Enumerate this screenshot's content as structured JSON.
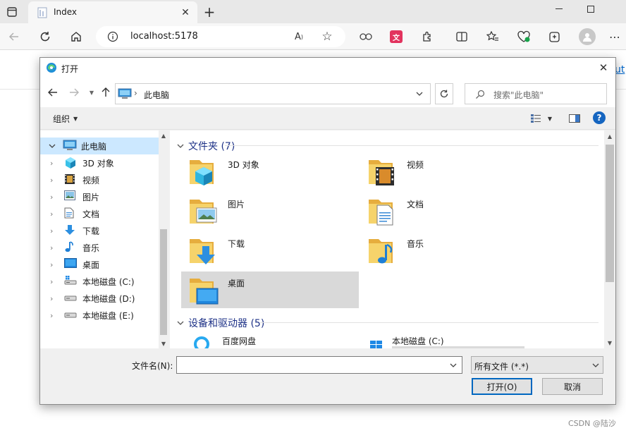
{
  "browser": {
    "tab_title": "Index",
    "url": "localhost:5178",
    "page_link_partial": "ut"
  },
  "dialog": {
    "title": "打开",
    "breadcrumb": "此电脑",
    "search_placeholder": "搜索\"此电脑\"",
    "organize_label": "组织",
    "nav_items": [
      {
        "label": "此电脑"
      },
      {
        "label": "3D 对象"
      },
      {
        "label": "视频"
      },
      {
        "label": "图片"
      },
      {
        "label": "文档"
      },
      {
        "label": "下载"
      },
      {
        "label": "音乐"
      },
      {
        "label": "桌面"
      },
      {
        "label": "本地磁盘 (C:)"
      },
      {
        "label": "本地磁盘 (D:)"
      },
      {
        "label": "本地磁盘 (E:)"
      }
    ],
    "folders_header": "文件夹 (7)",
    "folders": [
      {
        "label": "3D 对象"
      },
      {
        "label": "视频"
      },
      {
        "label": "图片"
      },
      {
        "label": "文档"
      },
      {
        "label": "下载"
      },
      {
        "label": "音乐"
      },
      {
        "label": "桌面"
      }
    ],
    "devices_header": "设备和驱动器 (5)",
    "devices": [
      {
        "label": "百度网盘"
      },
      {
        "label": "本地磁盘 (C:)"
      }
    ],
    "filename_label": "文件名(N):",
    "filename_value": "",
    "filetype_value": "所有文件 (*.*)",
    "open_label": "打开(O)",
    "cancel_label": "取消"
  },
  "watermark": "CSDN @陆沙",
  "colors": {
    "accent": "#0067c0",
    "selection": "#cce8ff",
    "group_header": "#1e3287",
    "folder_yellow": "#f2c55c"
  }
}
